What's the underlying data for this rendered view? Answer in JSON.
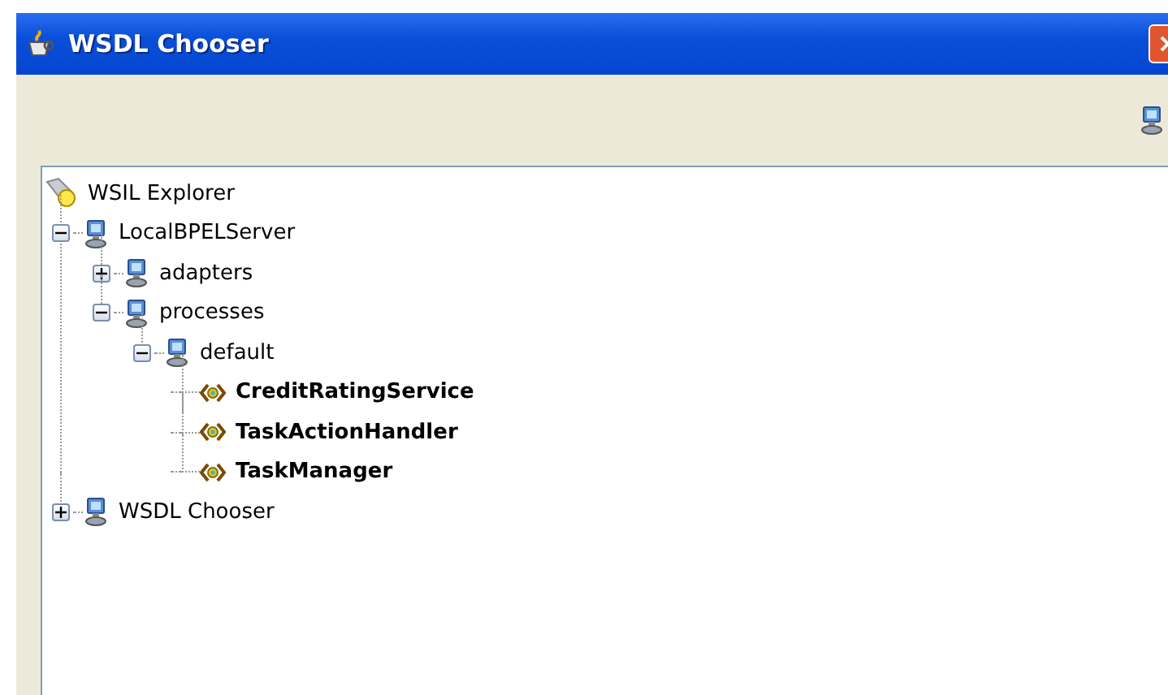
{
  "window": {
    "title": "WSDL Chooser"
  },
  "tree": {
    "label": "WSIL Explorer",
    "kind": "root",
    "children": [
      {
        "label": "LocalBPELServer",
        "kind": "server",
        "expanded": true,
        "children": [
          {
            "label": "adapters",
            "kind": "server",
            "expanded": false
          },
          {
            "label": "processes",
            "kind": "server",
            "expanded": true,
            "children": [
              {
                "label": "default",
                "kind": "server",
                "expanded": true,
                "children": [
                  {
                    "label": "CreditRatingService",
                    "kind": "service"
                  },
                  {
                    "label": "TaskActionHandler",
                    "kind": "service"
                  },
                  {
                    "label": "TaskManager",
                    "kind": "service"
                  }
                ]
              }
            ]
          }
        ]
      },
      {
        "label": "WSDL Chooser",
        "kind": "server",
        "expanded": false
      }
    ]
  }
}
